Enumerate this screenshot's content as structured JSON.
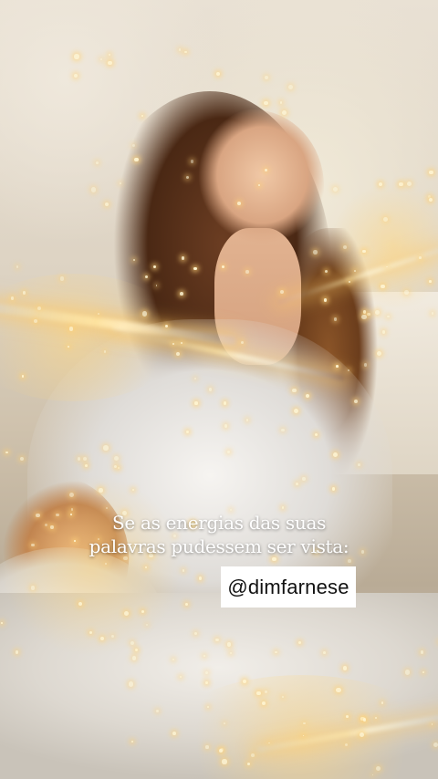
{
  "caption": {
    "line1": "Se as energias das suas",
    "line2": "palavras pudessem ser vista:"
  },
  "handle": {
    "text": "@dimfarnese"
  },
  "colors": {
    "caption_text": "#ffffff",
    "handle_bg": "#ffffff",
    "handle_text": "#111111",
    "sparkle": "#fff4cf"
  }
}
